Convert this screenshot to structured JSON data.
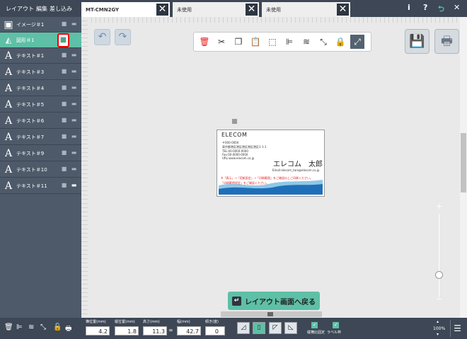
{
  "menu": {
    "layout": "レイアウト",
    "edit": "編集",
    "insert": "差し込み"
  },
  "tabs": [
    {
      "label": "MT-CMN2GY",
      "close": "✕"
    },
    {
      "label": "未使用",
      "close": "✕"
    },
    {
      "label": "未使用",
      "close": "✕"
    }
  ],
  "top_icons": {
    "info": "i",
    "help": "?",
    "back": "⮌",
    "close": "✕"
  },
  "layers": [
    {
      "label": "イメージ＃1",
      "type_icon": "image-icon"
    },
    {
      "label": "図形＃1",
      "type_icon": "shape-icon",
      "locked": true
    },
    {
      "label": "テキスト＃1",
      "type_icon": "text-icon",
      "glyph": "A"
    },
    {
      "label": "テキスト＃3",
      "type_icon": "text-icon",
      "glyph": "A"
    },
    {
      "label": "テキスト＃4",
      "type_icon": "text-icon",
      "glyph": "A"
    },
    {
      "label": "テキスト＃5",
      "type_icon": "text-icon",
      "glyph": "A"
    },
    {
      "label": "テキスト＃6",
      "type_icon": "text-icon",
      "glyph": "A"
    },
    {
      "label": "テキスト＃7",
      "type_icon": "text-icon",
      "glyph": "A"
    },
    {
      "label": "テキスト＃9",
      "type_icon": "text-icon",
      "glyph": "A"
    },
    {
      "label": "テキスト＃10",
      "type_icon": "text-icon",
      "glyph": "A"
    },
    {
      "label": "テキスト＃11",
      "type_icon": "text-icon",
      "glyph": "A"
    }
  ],
  "card": {
    "logo": "ELECOM",
    "address_line1": "〒000-0000",
    "address_line2": "東京都港区港区港区港区港区1-1-1",
    "tel": "TEL:00-0000-0000",
    "fax": "Fax:00-0000-0000",
    "url": "URL:www.elecom.co.jp",
    "name": "エレコム　太郎",
    "email": "Email:elecom_taro@elecom.co.jp",
    "warning_line1": "※「表示」→「用紙設定」→「印刷範囲」をご確認の上ご印刷ください。",
    "warning_line2": "「印刷範囲設定」をご確認ください。"
  },
  "back_button": {
    "label": "レイアウト画面へ戻る"
  },
  "zoom": {
    "plus": "+",
    "minus": "−",
    "level": "100%"
  },
  "fields": {
    "x_label": "横位置(mm)",
    "x_value": "4.2",
    "y_label": "縦位置(mm)",
    "y_value": "1.8",
    "h_label": "高さ(mm)",
    "h_value": "11.3",
    "w_label": "幅(mm)",
    "w_value": "42.7",
    "angle_label": "傾き(度)",
    "angle_value": "0"
  },
  "checks": {
    "aspect": "縦横比固定",
    "print": "ラベル枠"
  },
  "colors": {
    "accent": "#5ec0a6",
    "topbar": "#3d4756",
    "sidebar": "#4e5a6a",
    "highlight": "#e00000"
  }
}
